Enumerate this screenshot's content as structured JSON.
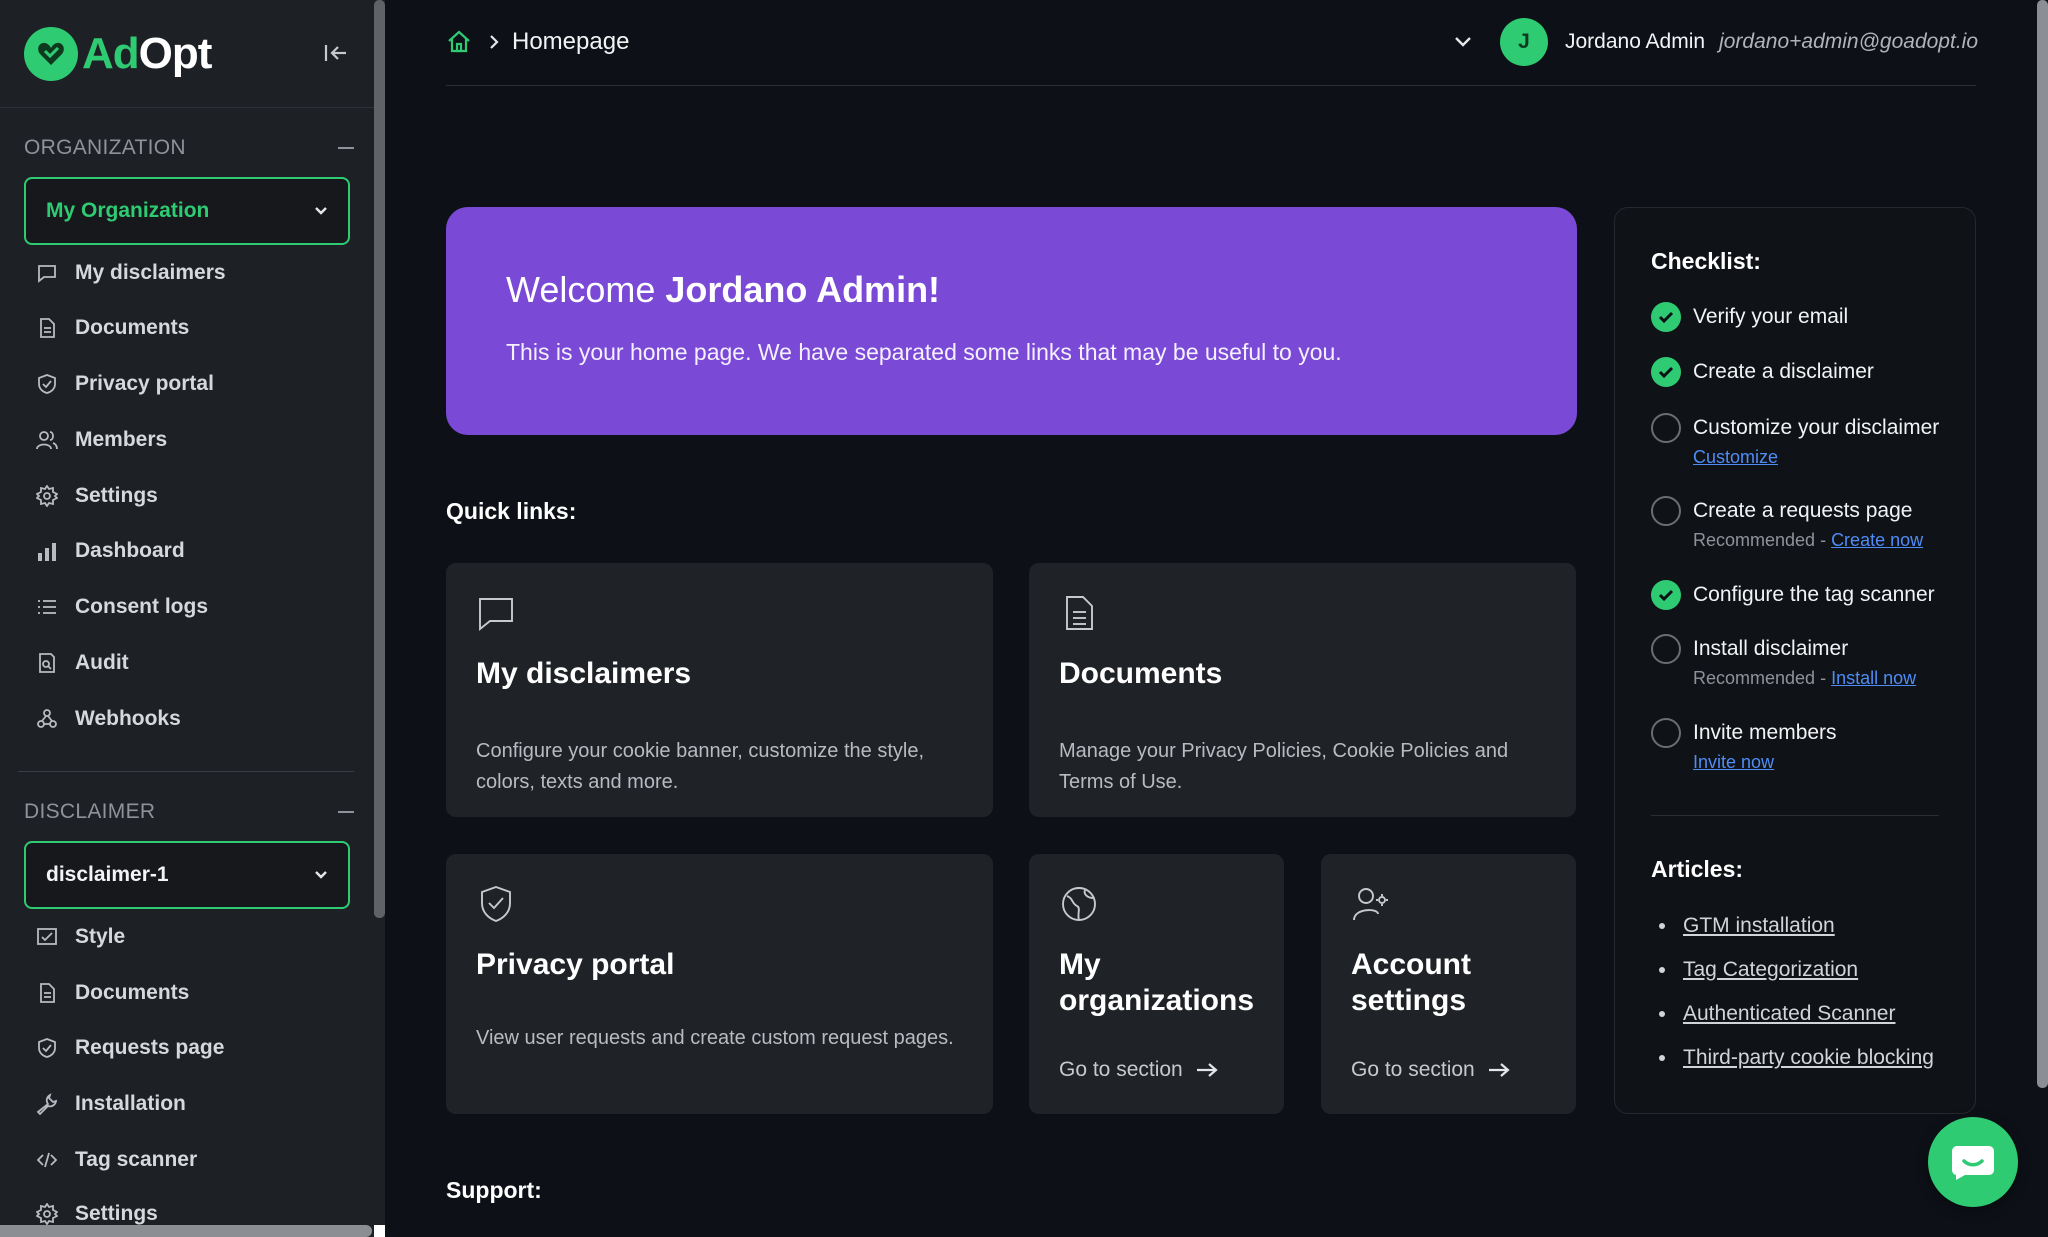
{
  "brand": {
    "part1": "Ad",
    "part2": "Opt"
  },
  "sidebar": {
    "org_section": "ORGANIZATION",
    "org_select": "My Organization",
    "org_items": [
      {
        "label": "My disclaimers",
        "icon": "chat-icon"
      },
      {
        "label": "Documents",
        "icon": "document-icon"
      },
      {
        "label": "Privacy portal",
        "icon": "shield-icon"
      },
      {
        "label": "Members",
        "icon": "users-icon"
      },
      {
        "label": "Settings",
        "icon": "gear-icon"
      },
      {
        "label": "Dashboard",
        "icon": "bar-chart-icon"
      },
      {
        "label": "Consent logs",
        "icon": "list-icon"
      },
      {
        "label": "Audit",
        "icon": "audit-icon"
      },
      {
        "label": "Webhooks",
        "icon": "webhook-icon"
      }
    ],
    "disclaimer_section": "DISCLAIMER",
    "disclaimer_select": "disclaimer-1",
    "disclaimer_items": [
      {
        "label": "Style",
        "icon": "style-icon"
      },
      {
        "label": "Documents",
        "icon": "document-icon"
      },
      {
        "label": "Requests page",
        "icon": "shield-icon"
      },
      {
        "label": "Installation",
        "icon": "wrench-icon"
      },
      {
        "label": "Tag scanner",
        "icon": "code-icon"
      },
      {
        "label": "Settings",
        "icon": "gear-icon"
      }
    ]
  },
  "header": {
    "breadcrumb": "Homepage",
    "user_initial": "J",
    "user_name": "Jordano Admin",
    "user_email": "jordano+admin@goadopt.io"
  },
  "welcome": {
    "greeting": "Welcome ",
    "name": "Jordano Admin!",
    "text": "This is your home page. We have separated some links that may be useful to you."
  },
  "quick_links_title": "Quick links:",
  "cards": {
    "disclaimers": {
      "title": "My disclaimers",
      "desc": "Configure your cookie banner, customize the style, colors, texts and more."
    },
    "documents": {
      "title": "Documents",
      "desc": "Manage your Privacy Policies, Cookie Policies and Terms of Use."
    },
    "privacy": {
      "title": "Privacy portal",
      "desc": "View user requests and create custom request pages."
    },
    "orgs": {
      "title": "My organizations",
      "link": "Go to section"
    },
    "account": {
      "title": "Account settings",
      "link": "Go to section"
    }
  },
  "support_title": "Support:",
  "checklist": {
    "title": "Checklist:",
    "items": [
      {
        "label": "Verify your email",
        "done": true
      },
      {
        "label": "Create a disclaimer",
        "done": true
      },
      {
        "label": "Customize your disclaimer",
        "done": false,
        "link": "Customize"
      },
      {
        "label": "Create a requests page",
        "done": false,
        "note": "Recommended - ",
        "link": "Create now"
      },
      {
        "label": "Configure the tag scanner",
        "done": true
      },
      {
        "label": "Install disclaimer",
        "done": false,
        "note": "Recommended - ",
        "link": "Install now"
      },
      {
        "label": "Invite members",
        "done": false,
        "link": "Invite now"
      }
    ]
  },
  "articles": {
    "title": "Articles:",
    "items": [
      "GTM installation",
      "Tag Categorization",
      "Authenticated Scanner",
      "Third-party cookie blocking"
    ]
  },
  "colors": {
    "accent": "#2fcb73",
    "banner": "#7a4ad6",
    "link": "#4f8cf6"
  }
}
